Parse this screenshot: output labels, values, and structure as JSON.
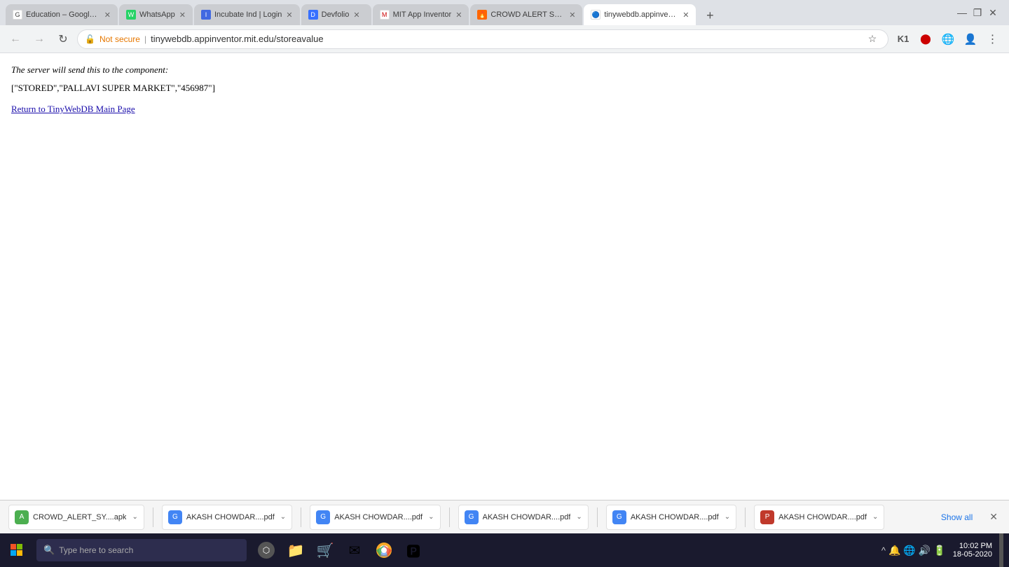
{
  "browser": {
    "tabs": [
      {
        "id": "tab1",
        "title": "Education – Google AI",
        "favicon": "google",
        "active": false,
        "closable": true
      },
      {
        "id": "tab2",
        "title": "WhatsApp",
        "favicon": "whatsapp",
        "active": false,
        "closable": true
      },
      {
        "id": "tab3",
        "title": "Incubate Ind | Login",
        "favicon": "incubate",
        "active": false,
        "closable": true
      },
      {
        "id": "tab4",
        "title": "Devfolio",
        "favicon": "devfolio",
        "active": false,
        "closable": true
      },
      {
        "id": "tab5",
        "title": "MIT App Inventor",
        "favicon": "mit",
        "active": false,
        "closable": true
      },
      {
        "id": "tab6",
        "title": "CROWD ALERT SYSTE...",
        "favicon": "crowd",
        "active": false,
        "closable": true
      },
      {
        "id": "tab7",
        "title": "tinywebdb.appinvento...",
        "favicon": "tinydb",
        "active": true,
        "closable": true
      }
    ],
    "address_bar": {
      "protocol": "Not secure",
      "url": "tinywebdb.appinventor.mit.edu/storeavalue"
    },
    "window_controls": {
      "minimize": "—",
      "maximize": "❐",
      "close": "✕"
    }
  },
  "page": {
    "server_message": "The server will send this to the component:",
    "stored_data": "[\"STORED\",\"PALLAVI SUPER MARKET\",\"456987\"]",
    "return_link_text": "Return to TinyWebDB Main Page"
  },
  "downloads_bar": {
    "items": [
      {
        "id": "dl1",
        "name": "CROWD_ALERT_SY....apk",
        "icon_type": "apk",
        "icon_color": "#4caf50"
      },
      {
        "id": "dl2",
        "name": "AKASH CHOWDAR....pdf",
        "icon_type": "pdf_chrome",
        "icon_color": "#4285f4"
      },
      {
        "id": "dl3",
        "name": "AKASH CHOWDAR....pdf",
        "icon_type": "pdf_chrome",
        "icon_color": "#4285f4"
      },
      {
        "id": "dl4",
        "name": "AKASH CHOWDAR....pdf",
        "icon_type": "pdf_chrome",
        "icon_color": "#4285f4"
      },
      {
        "id": "dl5",
        "name": "AKASH CHOWDAR....pdf",
        "icon_type": "pdf_chrome",
        "icon_color": "#4285f4"
      },
      {
        "id": "dl6",
        "name": "AKASH CHOWDAR....pdf",
        "icon_type": "pdf_red",
        "icon_color": "#c0392b"
      }
    ],
    "show_all_label": "Show all",
    "close_label": "✕"
  },
  "taskbar": {
    "start_icon": "⊞",
    "search_placeholder": "Type here to search",
    "taskbar_icons": [
      {
        "id": "ti1",
        "icon": "⬡",
        "color": "#555"
      },
      {
        "id": "ti2",
        "icon": "📁",
        "color": "#e8a000"
      },
      {
        "id": "ti3",
        "icon": "🛒",
        "color": "#00a4ef"
      },
      {
        "id": "ti4",
        "icon": "✉",
        "color": "#0078d4"
      },
      {
        "id": "ti5",
        "icon": "🌐",
        "color": "#f9a825"
      },
      {
        "id": "ti6",
        "icon": "🅿",
        "color": "#cc0000"
      }
    ],
    "sys_tray": {
      "icons": [
        "^",
        "🔔",
        "🌐",
        "🔊",
        "🔋"
      ],
      "show_hidden": "^"
    },
    "clock": {
      "time": "10:02 PM",
      "date": "18-05-2020"
    }
  }
}
